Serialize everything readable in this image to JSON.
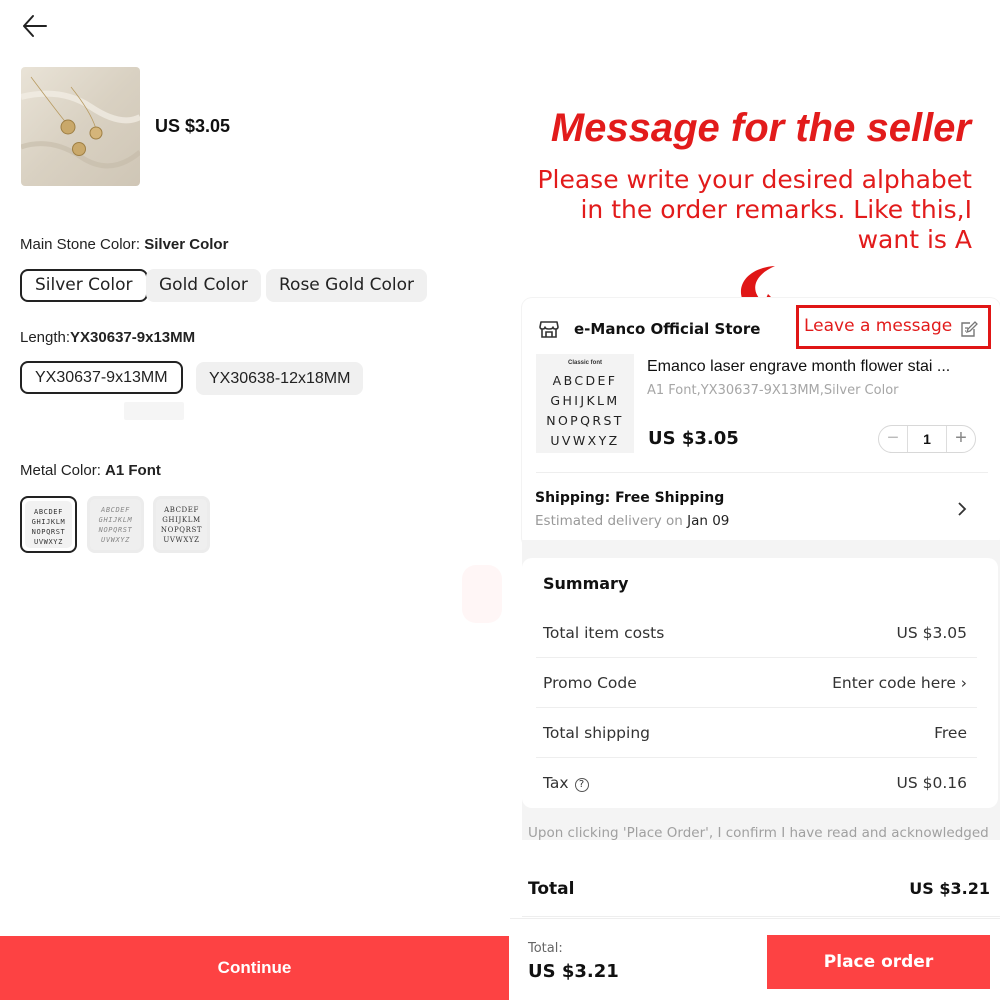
{
  "left": {
    "price": "US $3.05",
    "stone": {
      "label": "Main Stone Color:",
      "selected": "Silver Color",
      "options": [
        "Silver Color",
        "Gold Color",
        "Rose Gold Color"
      ]
    },
    "length": {
      "label": "Length:",
      "selected": "YX30637-9x13MM",
      "options": [
        "YX30637-9x13MM",
        "YX30638-12x18MM"
      ]
    },
    "metal": {
      "label": "Metal Color:",
      "selected": "A1 Font"
    },
    "continue_label": "Continue"
  },
  "right": {
    "headline": "Message for the seller",
    "instruction": "Please write your desired alphabet in the order remarks. Like this,I want is A",
    "store_name": "e-Manco Official Store",
    "leave_message": "Leave a message",
    "product": {
      "image_caption": "Classic font",
      "image_rows": [
        "ABCDEF",
        "GHIJKLM",
        "NOPQRST",
        "UVWXYZ"
      ],
      "title": "Emanco laser engrave month flower stai ...",
      "variant": "A1 Font,YX30637-9X13MM,Silver Color",
      "price": "US $3.05",
      "quantity": "1"
    },
    "shipping": {
      "title": "Shipping: Free Shipping",
      "estimated_prefix": "Estimated delivery on",
      "estimated_date": "Jan 09"
    },
    "summary": {
      "title": "Summary",
      "rows": [
        {
          "label": "Total item costs",
          "value": "US $3.05"
        },
        {
          "label": "Promo Code",
          "value": "Enter code here"
        },
        {
          "label": "Total shipping",
          "value": "Free"
        },
        {
          "label": "Tax",
          "value": "US $0.16"
        }
      ]
    },
    "disclaimer": "Upon clicking 'Place Order', I confirm I have read and acknowledged",
    "total_label": "Total",
    "total_value": "US $3.21",
    "bottom_total_label": "Total:",
    "bottom_total_value": "US $3.21",
    "place_order_label": "Place order"
  },
  "colors": {
    "accent": "#fd4243",
    "annotation_red": "#e21b1b"
  }
}
